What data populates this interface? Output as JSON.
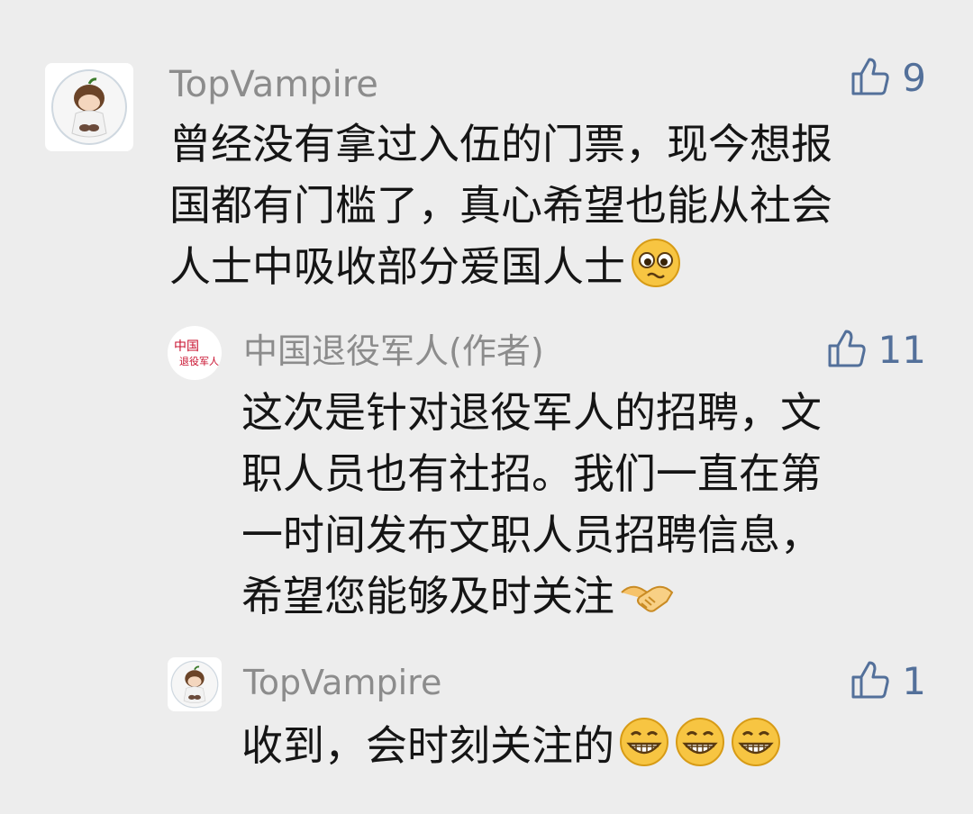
{
  "comments": [
    {
      "user": "TopVampire",
      "likes": "9",
      "lines": [
        "曾经没有拿过入伍的门票，现今想报",
        "国都有门槛了，真心希望也能从社会",
        "人士中吸收部分爱国人士"
      ],
      "emoji": "pleading-face-emoji"
    },
    {
      "user": "中国退役军人(作者)",
      "likes": "11",
      "avatar_text": "中国退役军人",
      "lines": [
        "这次是针对退役军人的招聘，文",
        "职人员也有社招。我们一直在第",
        "一时间发布文职人员招聘信息，",
        "希望您能够及时关注"
      ],
      "emoji": "handshake-emoji"
    },
    {
      "user": "TopVampire",
      "likes": "1",
      "lines": [
        "收到，会时刻关注的"
      ],
      "emoji": "grinning-face-emoji x3"
    }
  ],
  "colors": {
    "background": "#ededed",
    "username": "#8c8c8c",
    "like": "#53709a",
    "text": "#151515",
    "brand_red": "#c8102e"
  }
}
